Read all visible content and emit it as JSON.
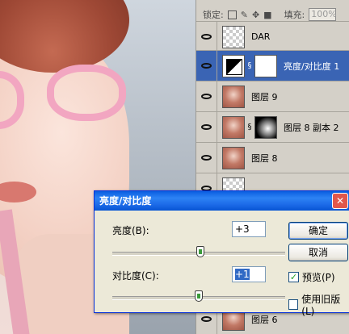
{
  "layers_panel": {
    "lock_label": "锁定:",
    "fill_label": "填充:",
    "fill_value": "100%",
    "layers": [
      {
        "name": "DAR",
        "thumb": "checker",
        "visible": true,
        "selected": false
      },
      {
        "name": "亮度/对比度 1",
        "thumb": "adjustment",
        "visible": true,
        "selected": true
      },
      {
        "name": "图层 9",
        "thumb": "photo",
        "visible": true,
        "selected": false
      },
      {
        "name": "图层 8 副本 2",
        "thumb": "photo",
        "visible": true,
        "selected": false
      },
      {
        "name": "图层 8",
        "thumb": "photo",
        "visible": true,
        "selected": false
      },
      {
        "name": "图层 6",
        "thumb": "photo",
        "visible": true,
        "selected": false
      }
    ]
  },
  "dialog": {
    "title": "亮度/对比度",
    "brightness_label": "亮度(B):",
    "brightness_value": "+3",
    "contrast_label": "对比度(C):",
    "contrast_value": "+1",
    "ok_label": "确定",
    "cancel_label": "取消",
    "preview_label": "预览(P)",
    "preview_checked": true,
    "legacy_label": "使用旧版(L)",
    "legacy_checked": false,
    "brightness_slider_fraction": 0.51,
    "contrast_slider_fraction": 0.5
  },
  "icons": {
    "eye": "eye-icon",
    "link": "chain-link-icon",
    "close": "close-icon"
  }
}
